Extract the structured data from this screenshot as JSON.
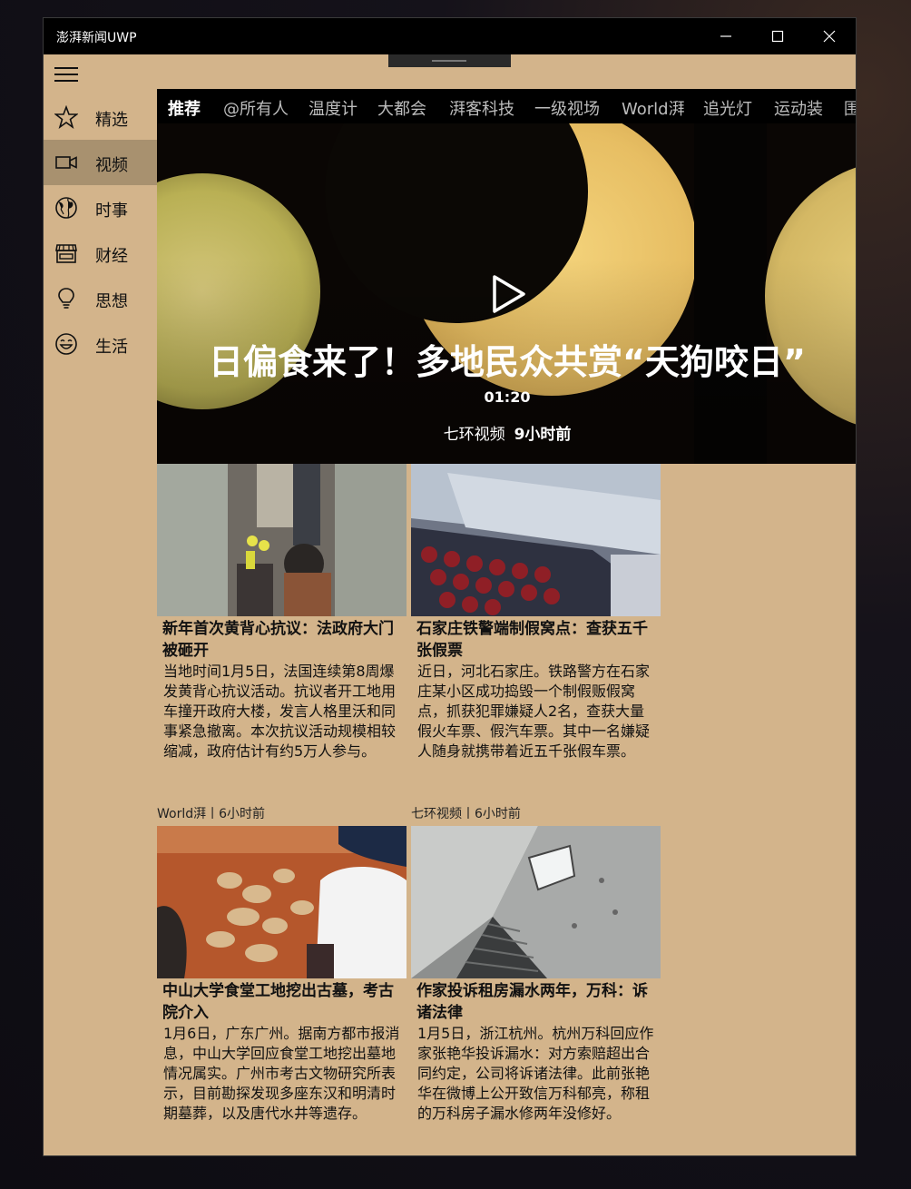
{
  "window": {
    "title": "澎湃新闻UWP"
  },
  "sidebar": {
    "items": [
      {
        "label": "精选",
        "icon": "star-icon"
      },
      {
        "label": "视频",
        "icon": "video-camera-icon",
        "active": true
      },
      {
        "label": "时事",
        "icon": "globe-icon"
      },
      {
        "label": "财经",
        "icon": "store-icon"
      },
      {
        "label": "思想",
        "icon": "lightbulb-icon"
      },
      {
        "label": "生活",
        "icon": "smiley-icon"
      }
    ]
  },
  "tabs": [
    "推荐",
    "@所有人",
    "温度计",
    "大都会",
    "湃客科技",
    "一级视场",
    "World湃",
    "追光灯",
    "运动装",
    "围"
  ],
  "hero": {
    "title": "日偏食来了！多地民众共赏“天狗咬日”",
    "duration": "01:20",
    "source": "七环视频",
    "time": "9小时前"
  },
  "cards": [
    {
      "title": "新年首次黄背心抗议：法政府大门被砸开",
      "desc": "当地时间1月5日，法国连续第8周爆发黄背心抗议活动。抗议者开工地用车撞开政府大楼，发言人格里沃和同事紧急撤离。本次抗议活动规模相较缩减，政府估计有约5万人参与。"
    },
    {
      "title": "石家庄铁警端制假窝点：查获五千张假票",
      "desc": "近日，河北石家庄。铁路警方在石家庄某小区成功捣毁一个制假贩假窝点，抓获犯罪嫌疑人2名，查获大量假火车票、假汽车票。其中一名嫌疑人随身就携带着近五千张假车票。"
    },
    {
      "source": "World湃丨6小时前",
      "title": "中山大学食堂工地挖出古墓，考古院介入",
      "desc": "1月6日，广东广州。据南方都市报消息，中山大学回应食堂工地挖出墓地情况属实。广州市考古文物研究所表示，目前勘探发现多座东汉和明清时期墓葬，以及唐代水井等遗存。"
    },
    {
      "source": "七环视频丨6小时前",
      "title": "作家投诉租房漏水两年，万科：诉诸法律",
      "desc": "1月5日，浙江杭州。杭州万科回应作家张艳华投诉漏水：对方索赔超出合同约定，公司将诉诸法律。此前张艳华在微博上公开致信万科郁亮，称租的万科房子漏水修两年没修好。"
    }
  ]
}
